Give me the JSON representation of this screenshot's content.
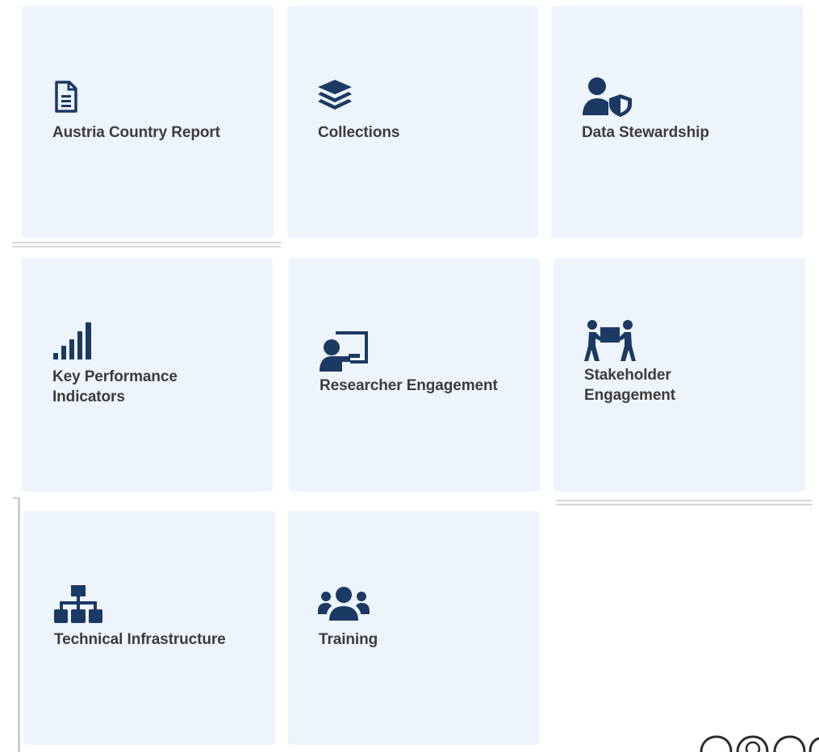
{
  "tiles": [
    {
      "label": "Austria Country Report",
      "icon": "document-icon"
    },
    {
      "label": "Collections",
      "icon": "layers-icon"
    },
    {
      "label": "Data Stewardship",
      "icon": "user-shield-icon"
    },
    {
      "label": "Key Performance\nIndicators",
      "icon": "signal-bars-icon"
    },
    {
      "label": "Researcher Engagement",
      "icon": "chalkboard-teacher-icon"
    },
    {
      "label": "Stakeholder\nEngagement",
      "icon": "people-carry-icon"
    },
    {
      "label": "Technical Infrastructure",
      "icon": "sitemap-icon"
    },
    {
      "label": "Training",
      "icon": "users-group-icon"
    }
  ],
  "colors": {
    "tile_background": "#eef4fc",
    "icon": "#1a3a64",
    "label": "#3c3c3c"
  }
}
